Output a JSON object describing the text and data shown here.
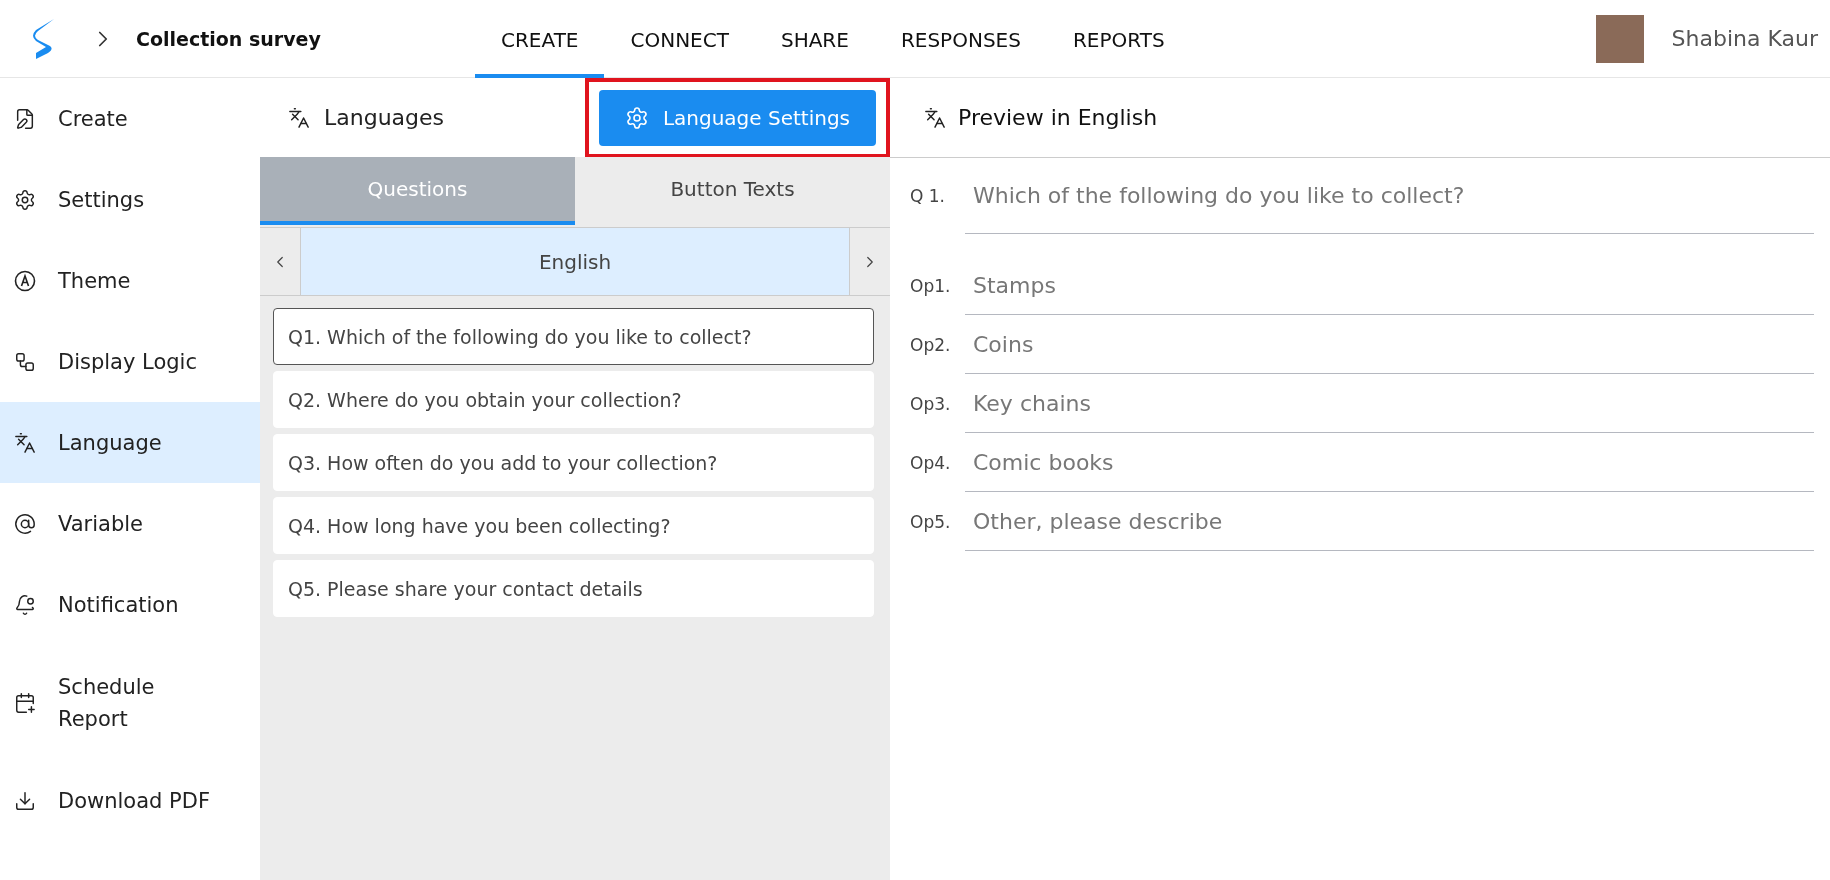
{
  "header": {
    "survey_title": "Collection survey",
    "nav_tabs": [
      {
        "label": "CREATE",
        "selected": true
      },
      {
        "label": "CONNECT",
        "selected": false
      },
      {
        "label": "SHARE",
        "selected": false
      },
      {
        "label": "RESPONSES",
        "selected": false
      },
      {
        "label": "REPORTS",
        "selected": false
      }
    ],
    "user_name": "Shabina Kaur"
  },
  "sidebar": {
    "items": [
      {
        "kind": "create",
        "label": "Create",
        "selected": false
      },
      {
        "kind": "settings",
        "label": "Settings",
        "selected": false
      },
      {
        "kind": "theme",
        "label": "Theme",
        "selected": false
      },
      {
        "kind": "logic",
        "label": "Display Logic",
        "selected": false
      },
      {
        "kind": "language",
        "label": "Language",
        "selected": true
      },
      {
        "kind": "variable",
        "label": "Variable",
        "selected": false
      },
      {
        "kind": "notification",
        "label": "Notification",
        "selected": false
      },
      {
        "kind": "schedule",
        "label": "Schedule Report",
        "selected": false
      },
      {
        "kind": "download",
        "label": "Download PDF",
        "selected": false
      }
    ]
  },
  "languages_panel": {
    "title": "Languages",
    "settings_button": {
      "label": "Language Settings",
      "highlighted": true
    },
    "tabs": [
      {
        "label": "Questions",
        "selected": true
      },
      {
        "label": "Button Texts",
        "selected": false
      }
    ],
    "current_language": "English",
    "questions": [
      {
        "text": "Q1. Which of the following do you like to collect?",
        "selected": true
      },
      {
        "text": "Q2. Where do you obtain your collection?",
        "selected": false
      },
      {
        "text": "Q3. How often do you add to your collection?",
        "selected": false
      },
      {
        "text": "Q4. How long have you been collecting?",
        "selected": false
      },
      {
        "text": "Q5. Please share your contact details",
        "selected": false
      }
    ]
  },
  "preview": {
    "title": "Preview in English",
    "question_number": "Q 1.",
    "question": "Which of the following do you like to collect?",
    "options": [
      {
        "number": "Op1.",
        "text": "Stamps"
      },
      {
        "number": "Op2.",
        "text": "Coins"
      },
      {
        "number": "Op3.",
        "text": "Key chains"
      },
      {
        "number": "Op4.",
        "text": "Comic books"
      },
      {
        "number": "Op5.",
        "text": "Other, please describe"
      }
    ]
  }
}
